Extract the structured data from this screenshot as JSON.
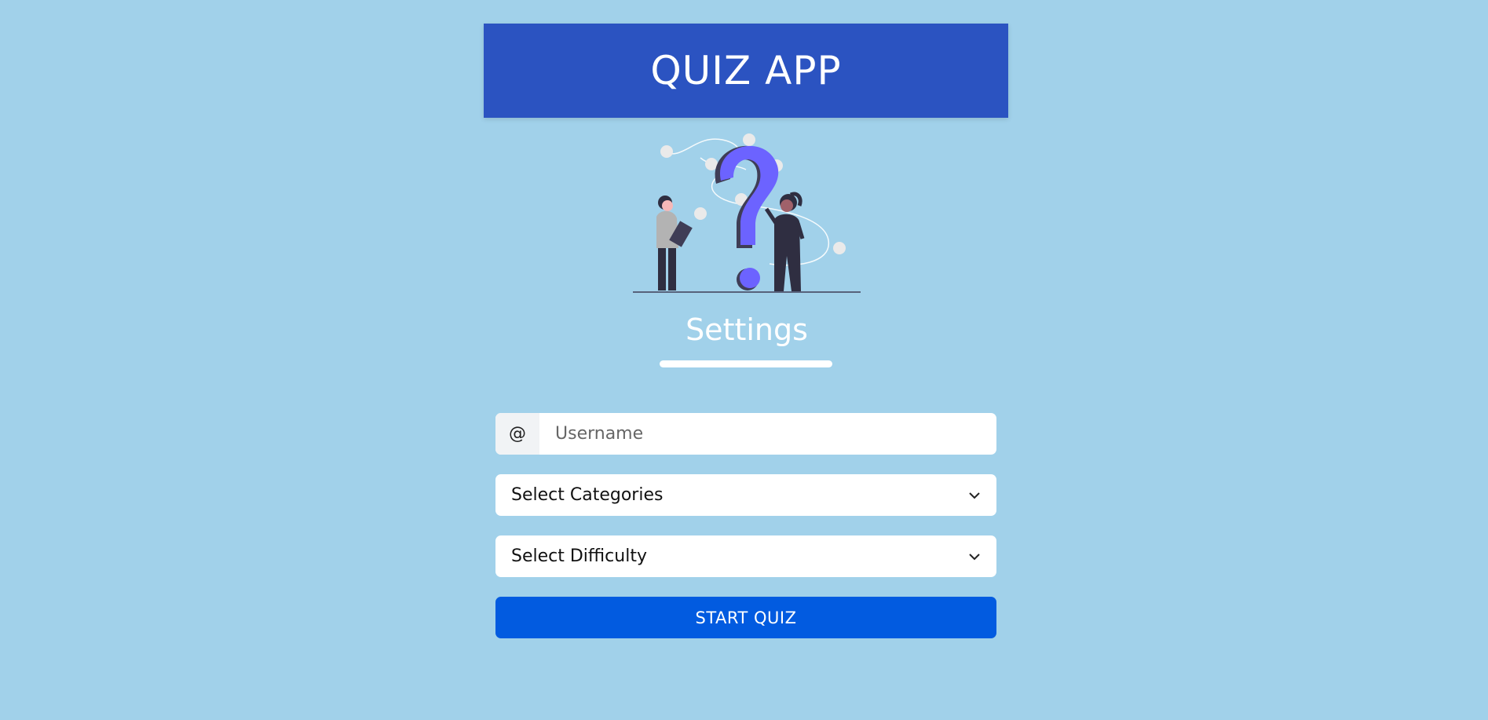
{
  "header": {
    "title": "QUIZ APP"
  },
  "illustration": {
    "icon": "question-people-illustration"
  },
  "settings": {
    "title": "Settings"
  },
  "form": {
    "username_prefix": "@",
    "username_placeholder": "Username",
    "username_value": "",
    "categories_label": "Select Categories",
    "difficulty_label": "Select Difficulty",
    "start_label": "START QUIZ"
  },
  "colors": {
    "page_background": "#a1d1ea",
    "header_background": "#2b53c1",
    "button_background": "#025be0",
    "question_mark": "#6c63ff"
  }
}
